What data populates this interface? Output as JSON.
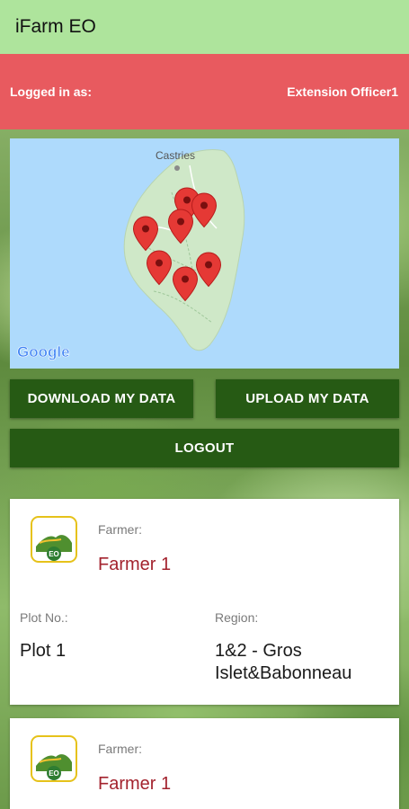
{
  "app": {
    "title": "iFarm EO"
  },
  "login": {
    "label": "Logged in as:",
    "user": "Extension Officer1"
  },
  "map": {
    "city_label": "Castries",
    "attribution": "Google",
    "marker_count": 7
  },
  "buttons": {
    "download": "DOWNLOAD MY DATA",
    "upload": "UPLOAD MY DATA",
    "logout": "LOGOUT"
  },
  "cards": [
    {
      "farmer_label": "Farmer:",
      "farmer": "Farmer 1",
      "plot_label": "Plot No.:",
      "plot": "Plot 1",
      "region_label": "Region:",
      "region": "1&2 - Gros Islet&Babonneau"
    },
    {
      "farmer_label": "Farmer:",
      "farmer": "Farmer 1"
    }
  ],
  "colors": {
    "appbar": "#aee49c",
    "login_bar": "#e85a5f",
    "button": "#265a14",
    "farmer_text": "#a3232e",
    "marker": "#e53935"
  }
}
